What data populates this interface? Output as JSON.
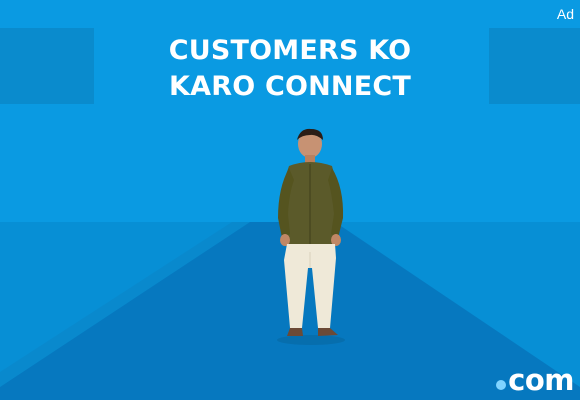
{
  "ad": {
    "label": "Ad",
    "headline_line1": "CUSTOMERS KO",
    "headline_line2": "KARO CONNECT",
    "logo_text": "com"
  },
  "colors": {
    "background": "#0a9ae2",
    "panel": "#0a8bcd",
    "floor": "#078fd5",
    "runway": "#0678bf",
    "text": "#ffffff"
  },
  "icons": [
    "person-image",
    "logo-dot-icon"
  ]
}
